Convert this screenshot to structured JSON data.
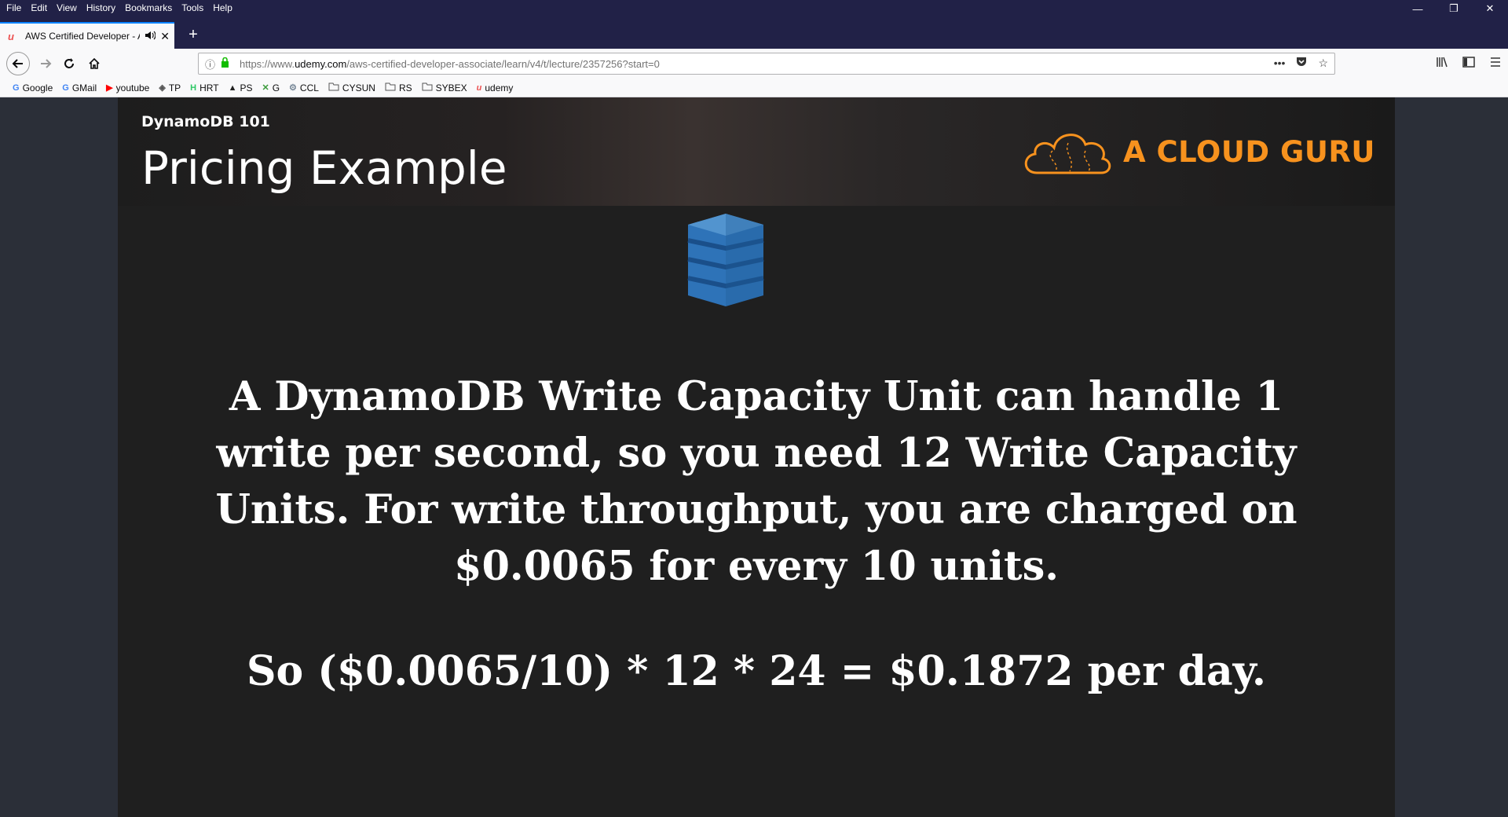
{
  "menubar": {
    "items": [
      "File",
      "Edit",
      "View",
      "History",
      "Bookmarks",
      "Tools",
      "Help"
    ]
  },
  "window_controls": {
    "minimize": "—",
    "restore": "❐",
    "close": "✕"
  },
  "tab": {
    "favicon": "u",
    "title": "AWS Certified Developer - A",
    "audio_icon": "speaker-icon",
    "close": "✕"
  },
  "newtab": "+",
  "navbar": {
    "url_prefix": "https://www.",
    "url_domain": "udemy.com",
    "url_path": "/aws-certified-developer-associate/learn/v4/t/lecture/2357256?start=0"
  },
  "bookmarks": [
    {
      "icon": "G",
      "label": "Google",
      "color": "#4285f4"
    },
    {
      "icon": "G",
      "label": "GMail",
      "color": "#4285f4"
    },
    {
      "icon": "▶",
      "label": "youtube",
      "color": "#ff0000"
    },
    {
      "icon": "◈",
      "label": "TP",
      "color": "#555555"
    },
    {
      "icon": "H",
      "label": "HRT",
      "color": "#2ec866"
    },
    {
      "icon": "▲",
      "label": "PS",
      "color": "#222222"
    },
    {
      "icon": "✕",
      "label": "G",
      "color": "#3a9a3a"
    },
    {
      "icon": "⚙",
      "label": "CCL",
      "color": "#7a8a9a"
    },
    {
      "icon": "📁",
      "label": "CYSUN",
      "color": "#666666"
    },
    {
      "icon": "📁",
      "label": "RS",
      "color": "#666666"
    },
    {
      "icon": "📁",
      "label": "SYBEX",
      "color": "#666666"
    },
    {
      "icon": "u",
      "label": "udemy",
      "color": "#ec5252"
    }
  ],
  "slide": {
    "course": "DynamoDB 101",
    "title": "Pricing Example",
    "logo_text": "A CLOUD GURU",
    "body_lines": [
      "A DynamoDB Write Capacity Unit can handle 1",
      "write per second, so you need 12 Write Capacity",
      "Units. For write throughput, you are charged on",
      "$0.0065 for every 10 units."
    ],
    "formula": "So ($0.0065/10) * 12 * 24 = $0.1872 per day."
  },
  "colors": {
    "accent": "#f7921e",
    "chrome": "#212147",
    "slide_bg": "#1f1f1f"
  }
}
